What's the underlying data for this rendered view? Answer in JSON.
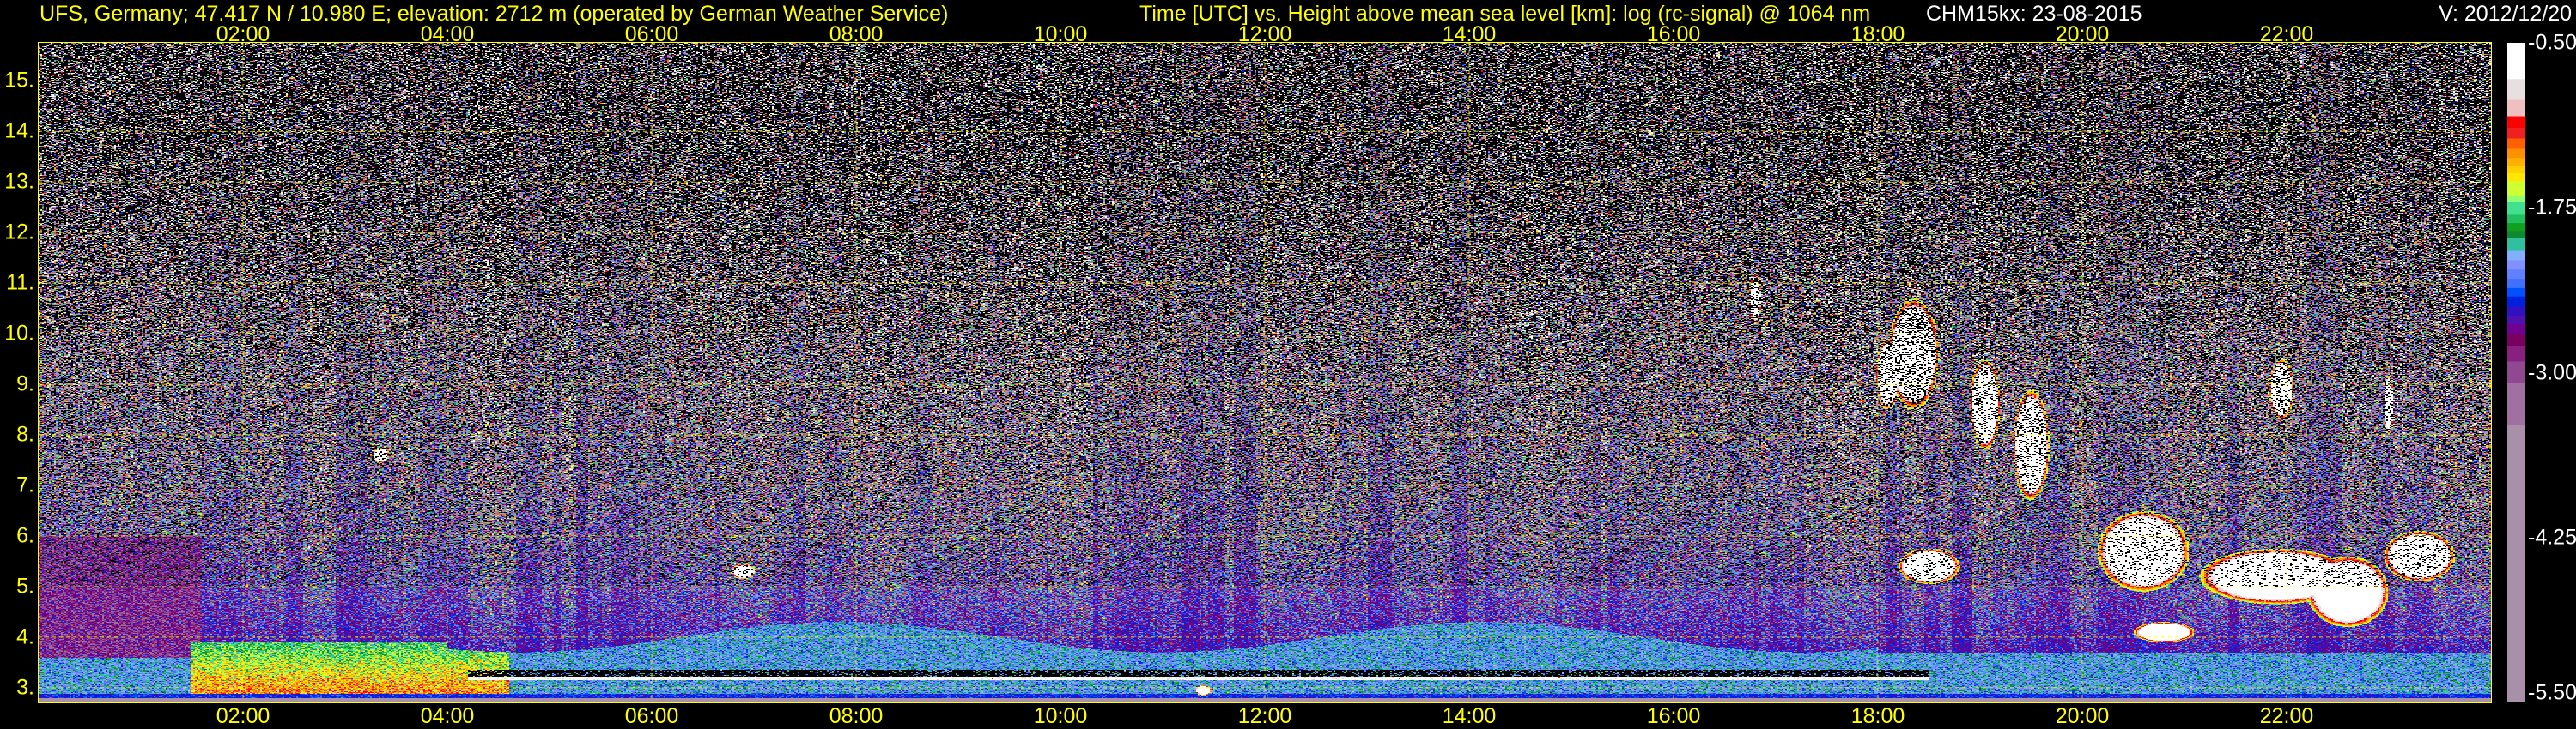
{
  "header": {
    "station": "UFS, Germany; 47.417 N / 10.980 E; elevation: 2712 m  (operated by German Weather Service)",
    "plot_description": "Time [UTC] vs. Height above mean sea level [km]: log (rc-signal) @ 1064 nm",
    "instrument_date": "CHM15kx: 23-08-2015",
    "version": "V: 2012/12/20"
  },
  "colors": {
    "text_accent": "#ffff00",
    "text_secondary": "#ffffff",
    "background": "#000000",
    "grid": "#ffff00"
  },
  "chart_data": {
    "type": "heatmap",
    "title": "Time [UTC] vs. Height above mean sea level [km]: log (rc-signal) @ 1064 nm",
    "xlabel": "Time [UTC]",
    "ylabel": "Height above mean sea level [km]",
    "xlim": [
      0,
      24
    ],
    "ylim": [
      2.71,
      15.75
    ],
    "grid": true,
    "x_ticks": [
      {
        "value": 2,
        "label": "02:00"
      },
      {
        "value": 4,
        "label": "04:00"
      },
      {
        "value": 6,
        "label": "06:00"
      },
      {
        "value": 8,
        "label": "08:00"
      },
      {
        "value": 10,
        "label": "10:00"
      },
      {
        "value": 12,
        "label": "12:00"
      },
      {
        "value": 14,
        "label": "14:00"
      },
      {
        "value": 16,
        "label": "16:00"
      },
      {
        "value": 18,
        "label": "18:00"
      },
      {
        "value": 20,
        "label": "20:00"
      },
      {
        "value": 22,
        "label": "22:00"
      }
    ],
    "y_ticks": [
      {
        "value": 3,
        "label": "3."
      },
      {
        "value": 4,
        "label": "4."
      },
      {
        "value": 5,
        "label": "5."
      },
      {
        "value": 6,
        "label": "6."
      },
      {
        "value": 7,
        "label": "7."
      },
      {
        "value": 8,
        "label": "8."
      },
      {
        "value": 9,
        "label": "9."
      },
      {
        "value": 10,
        "label": "10."
      },
      {
        "value": 11,
        "label": "11."
      },
      {
        "value": 12,
        "label": "12."
      },
      {
        "value": 13,
        "label": "13."
      },
      {
        "value": 14,
        "label": "14."
      },
      {
        "value": 15,
        "label": "15."
      }
    ],
    "colorbar": {
      "range": [
        -5.5,
        -0.5
      ],
      "ticks": [
        {
          "value": -0.5,
          "label": "-0.50"
        },
        {
          "value": -1.75,
          "label": "-1.75"
        },
        {
          "value": -3.0,
          "label": "-3.00"
        },
        {
          "value": -4.25,
          "label": "-4.25"
        },
        {
          "value": -5.5,
          "label": "-5.50"
        }
      ],
      "levels": [
        {
          "upper": -0.5,
          "color": "#ffffff"
        },
        {
          "upper": -0.775,
          "color": "#e8dfe0"
        },
        {
          "upper": -0.933,
          "color": "#f0c0c0"
        },
        {
          "upper": -1.056,
          "color": "#ff0000"
        },
        {
          "upper": -1.144,
          "color": "#f02020"
        },
        {
          "upper": -1.225,
          "color": "#ff6000"
        },
        {
          "upper": -1.303,
          "color": "#ff9000"
        },
        {
          "upper": -1.373,
          "color": "#ffb000"
        },
        {
          "upper": -1.433,
          "color": "#ffd000"
        },
        {
          "upper": -1.489,
          "color": "#ffe800"
        },
        {
          "upper": -1.549,
          "color": "#d0ff30"
        },
        {
          "upper": -1.655,
          "color": "#90ff70"
        },
        {
          "upper": -1.708,
          "color": "#40e090"
        },
        {
          "upper": -1.803,
          "color": "#20c060"
        },
        {
          "upper": -1.866,
          "color": "#10a020"
        },
        {
          "upper": -1.926,
          "color": "#108830"
        },
        {
          "upper": -1.979,
          "color": "#30c0a0"
        },
        {
          "upper": -2.077,
          "color": "#80b0ff"
        },
        {
          "upper": -2.148,
          "color": "#8090ff"
        },
        {
          "upper": -2.218,
          "color": "#6080ff"
        },
        {
          "upper": -2.289,
          "color": "#4070ff"
        },
        {
          "upper": -2.359,
          "color": "#0050ff"
        },
        {
          "upper": -2.423,
          "color": "#0020e0"
        },
        {
          "upper": -2.5,
          "color": "#3010c0"
        },
        {
          "upper": -2.57,
          "color": "#5010b0"
        },
        {
          "upper": -2.634,
          "color": "#700090"
        },
        {
          "upper": -2.711,
          "color": "#780060"
        },
        {
          "upper": -2.8,
          "color": "#882080"
        },
        {
          "upper": -2.915,
          "color": "#904890"
        },
        {
          "upper": -3.081,
          "color": "#a070a0"
        },
        {
          "upper": -3.398,
          "color": "#a890a8"
        }
      ]
    }
  }
}
